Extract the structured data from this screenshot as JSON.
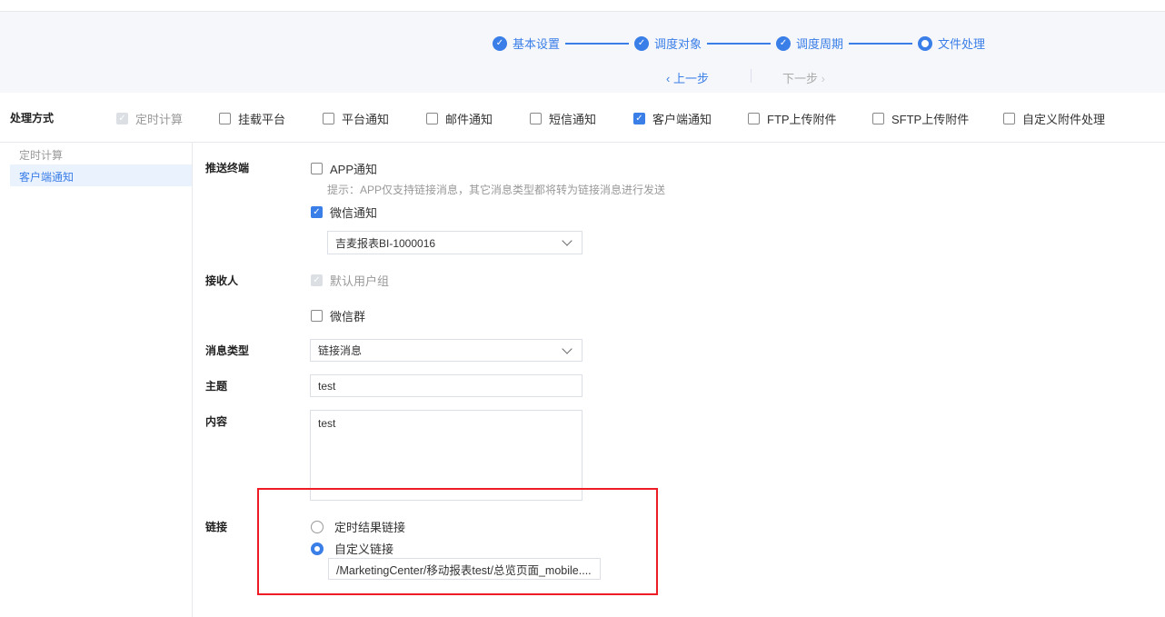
{
  "steps": [
    {
      "label": "基本设置",
      "state": "done"
    },
    {
      "label": "调度对象",
      "state": "done"
    },
    {
      "label": "调度周期",
      "state": "done"
    },
    {
      "label": "文件处理",
      "state": "current"
    }
  ],
  "nav": {
    "prev": "上一步",
    "next": "下一步"
  },
  "processing": {
    "label": "处理方式",
    "options": [
      {
        "label": "定时计算",
        "checked": true,
        "disabled": true
      },
      {
        "label": "挂载平台",
        "checked": false
      },
      {
        "label": "平台通知",
        "checked": false
      },
      {
        "label": "邮件通知",
        "checked": false
      },
      {
        "label": "短信通知",
        "checked": false
      },
      {
        "label": "客户端通知",
        "checked": true
      },
      {
        "label": "FTP上传附件",
        "checked": false
      },
      {
        "label": "SFTP上传附件",
        "checked": false
      },
      {
        "label": "自定义附件处理",
        "checked": false
      }
    ]
  },
  "sidebar": {
    "items": [
      "定时计算",
      "客户端通知"
    ],
    "active": 1
  },
  "form": {
    "terminal_label": "推送终端",
    "app": "APP通知",
    "hint": "提示：APP仅支持链接消息，其它消息类型都将转为链接消息进行发送",
    "wechat": "微信通知",
    "wechat_account": "吉麦报表BI-1000016",
    "receiver_label": "接收人",
    "default_group": "默认用户组",
    "wechat_group": "微信群",
    "msgtype_label": "消息类型",
    "msgtype": "链接消息",
    "subject_label": "主题",
    "subject": "test",
    "content_label": "内容",
    "content": "test",
    "link_label": "链接",
    "link_opt1": "定时结果链接",
    "link_opt2": "自定义链接",
    "link_value": "/MarketingCenter/移动报表test/总览页面_mobile...."
  },
  "colors": {
    "accent": "#3a7ee8",
    "highlight": "#ee1c25"
  }
}
